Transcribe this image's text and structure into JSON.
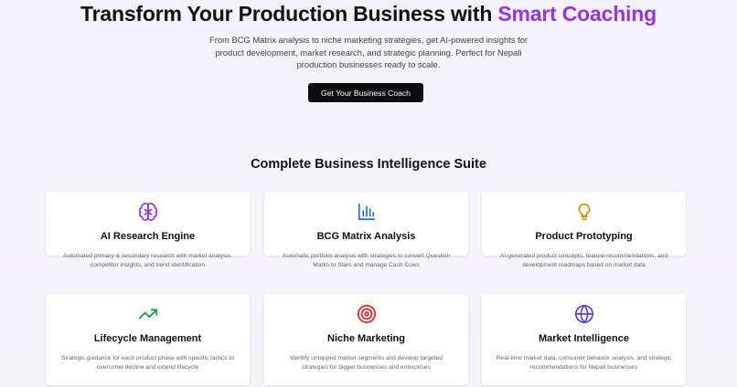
{
  "hero": {
    "title_main": "Transform Your Production Business with ",
    "title_accent": "Smart Coaching",
    "subtitle": "From BCG Matrix analysis to niche marketing strategies, get AI-powered insights for product development, market research, and strategic planning. Perfect for Nepali production businesses ready to scale.",
    "cta_label": "Get Your Business Coach"
  },
  "suite": {
    "title": "Complete Business Intelligence Suite",
    "features": [
      {
        "icon": "brain-icon",
        "icon_color": "#9333ea",
        "title": "AI Research Engine",
        "description": "Automated primary & secondary research with market analysis, competitor insights, and trend identification"
      },
      {
        "icon": "bar-chart-icon",
        "icon_color": "#2563eb",
        "title": "BCG Matrix Analysis",
        "description": "Automatic portfolio analysis with strategies to convert Question Marks to Stars and manage Cash Cows"
      },
      {
        "icon": "lightbulb-icon",
        "icon_color": "#ca8a04",
        "title": "Product Prototyping",
        "description": "AI-generated product concepts, feature recommendations, and development roadmaps based on market data"
      },
      {
        "icon": "trending-up-icon",
        "icon_color": "#16a34a",
        "title": "Lifecycle Management",
        "description": "Strategic guidance for each product phase with specific tactics to overcome decline and extend lifecycle"
      },
      {
        "icon": "target-icon",
        "icon_color": "#dc2626",
        "title": "Niche Marketing",
        "description": "Identify untapped market segments and develop targeted strategies for bigger businesses and enterprises"
      },
      {
        "icon": "globe-icon",
        "icon_color": "#4f46e5",
        "title": "Market Intelligence",
        "description": "Real-time market data, consumer behavior analysis, and strategic recommendations for Nepali businesses"
      }
    ]
  }
}
